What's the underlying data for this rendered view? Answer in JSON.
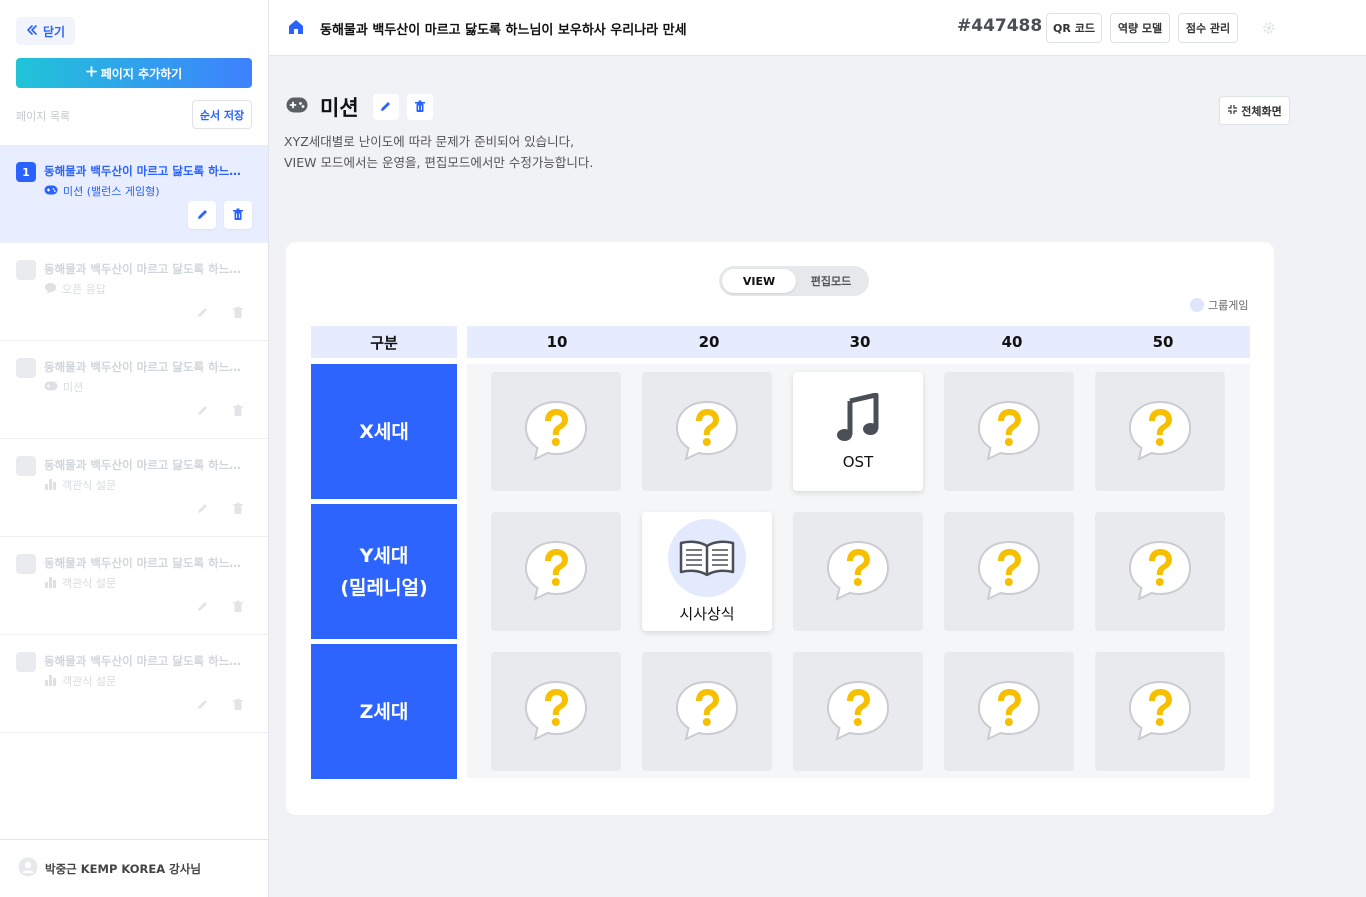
{
  "sidebar": {
    "close_label": "닫기",
    "add_page_label": "페이지 추가하기",
    "list_label": "페이지 목록",
    "save_order_label": "순서 저장",
    "pages": [
      {
        "num": "1",
        "title": "동해물과 백두산이 마르고 닳도록 하느님이...",
        "type": "미션 (밸런스 게임형)",
        "type_icon": "gamepad-icon"
      },
      {
        "num": "",
        "title": "동해물과 백두산이 마르고 닳도록 하느님이...",
        "type": "오픈 응답",
        "type_icon": "chat-bubble-icon"
      },
      {
        "num": "",
        "title": "동해물과 백두산이 마르고 닳도록 하느님이...",
        "type": "미션",
        "type_icon": "gamepad-icon"
      },
      {
        "num": "",
        "title": "동해물과 백두산이 마르고 닳도록 하느님이...",
        "type": "객관식 설문",
        "type_icon": "bar-chart-icon"
      },
      {
        "num": "",
        "title": "동해물과 백두산이 마르고 닳도록 하느님이...",
        "type": "객관식 설문",
        "type_icon": "bar-chart-icon"
      },
      {
        "num": "",
        "title": "동해물과 백두산이 마르고 닳도록 하느님이...",
        "type": "객관식 설문",
        "type_icon": "bar-chart-icon"
      }
    ],
    "user_name": "박중근 KEMP KOREA 강사님"
  },
  "topbar": {
    "title": "동해물과 백두산이 마르고 닳도록 하느님이 보우하사 우리나라 만세",
    "code": "#447488",
    "qr_label": "QR 코드",
    "competency_label": "역량 모델",
    "score_label": "점수 관리"
  },
  "mission": {
    "title": "미션",
    "desc_line1": "XYZ세대별로 난이도에 따라 문제가 준비되어 있습니다,",
    "desc_line2": "VIEW 모드에서는 운영을, 편집모드에서만 수정가능합니다.",
    "fullscreen_label": "전체화면"
  },
  "board": {
    "mode_view": "VIEW",
    "mode_edit": "편집모드",
    "group_legend": "그룹게임",
    "corner_label": "구분",
    "columns": [
      "10",
      "20",
      "30",
      "40",
      "50"
    ],
    "rows": [
      "X세대",
      "Y세대\n(밀레니얼)",
      "Z세대"
    ],
    "open_cells": [
      {
        "row": 0,
        "col": 2,
        "label": "OST",
        "icon": "music-note-icon"
      },
      {
        "row": 1,
        "col": 1,
        "label": "시사상식",
        "icon": "open-book-icon"
      }
    ]
  },
  "colors": {
    "accent": "#2962ff",
    "row_header": "#2e64fe",
    "question_yellow": "#f6c000",
    "column_header_bg": "#e6ecfd"
  }
}
